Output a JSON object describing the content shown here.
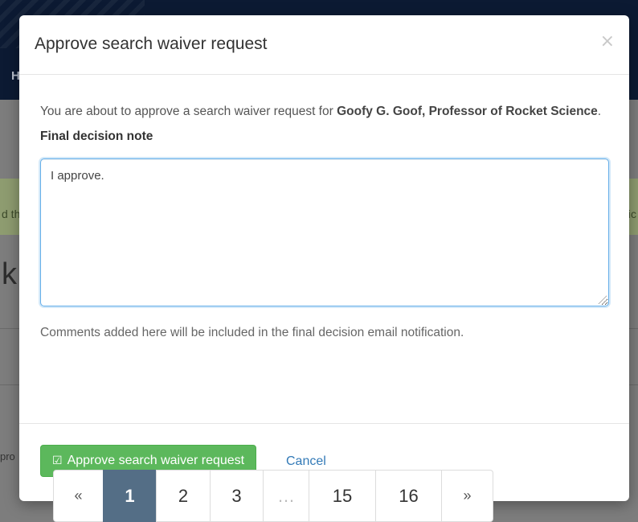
{
  "background": {
    "nav_letter": "H",
    "alert_left": "d th",
    "alert_right": "ic",
    "heading_fragment": "k",
    "row_fragment": "pro"
  },
  "modal": {
    "title": "Approve search waiver request",
    "close_label": "×",
    "intro_prefix": "You are about to approve a search waiver request for ",
    "intro_name": "Goofy G. Goof, Professor of Rocket Science",
    "intro_suffix": ".",
    "field_label": "Final decision note",
    "note_value": "I approve.",
    "help_text": "Comments added here will be included in the final decision email notification.",
    "approve_icon": "check-square-icon",
    "approve_check_glyph": "☑",
    "approve_label": "Approve search waiver request",
    "cancel_label": "Cancel"
  },
  "pagination": {
    "prev_label": "«",
    "pages": [
      "1",
      "2",
      "3",
      "…",
      "15",
      "16"
    ],
    "next_label": "»",
    "active_page": "1"
  },
  "colors": {
    "primary_button": "#5cb85c",
    "link": "#337ab7",
    "active_page": "#546e86",
    "input_focus": "#66afe9"
  }
}
